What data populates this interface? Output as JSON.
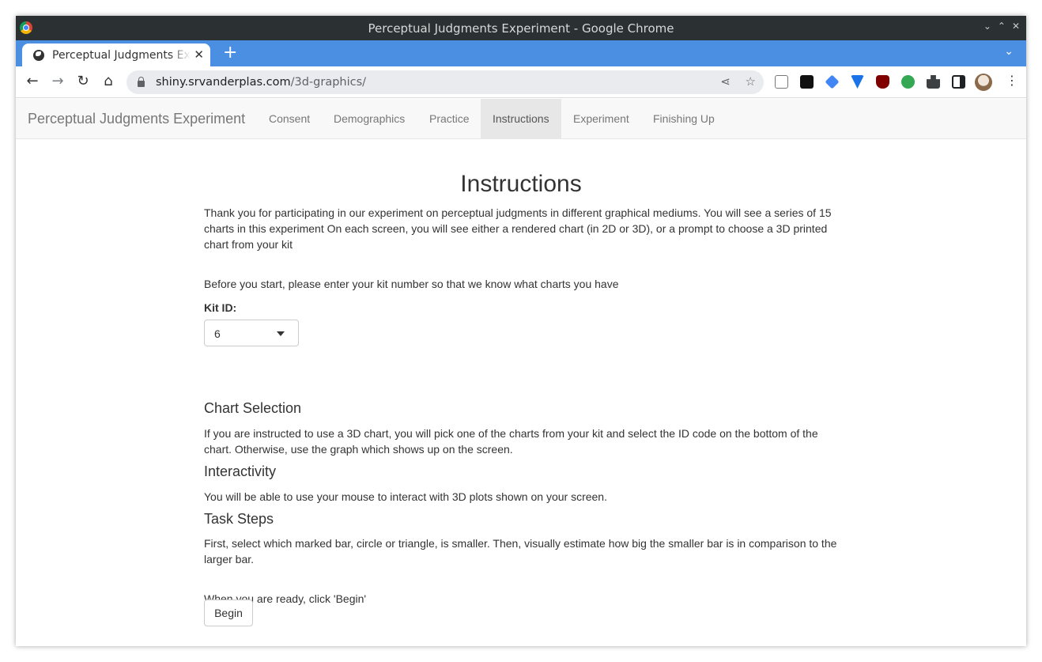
{
  "window": {
    "title": "Perceptual Judgments Experiment - Google Chrome",
    "controls": [
      "⌄",
      "⌃",
      "✕"
    ]
  },
  "browser": {
    "tab_title": "Perceptual Judgments Experiment",
    "tab_close": "✕",
    "new_tab": "+",
    "tab_menu": "⌄",
    "url_host": "shiny.srvanderplas.com",
    "url_path": "/3d-graphics/",
    "nav": {
      "back": "←",
      "forward": "→",
      "reload": "↻",
      "home": "⌂"
    },
    "share": "⋖",
    "star": "☆",
    "menu": "⋮",
    "extensions": [
      {
        "name": "reader-mode-icon",
        "color": "#5f6368"
      },
      {
        "name": "notion-icon",
        "color": "#111111"
      },
      {
        "name": "graduation-cap-icon",
        "color": "#4285f4"
      },
      {
        "name": "v-extension-icon",
        "color": "#1a73e8"
      },
      {
        "name": "ublock-origin-icon",
        "color": "#800000"
      },
      {
        "name": "green-extension-icon",
        "color": "#34a853"
      },
      {
        "name": "puzzle-piece-icon",
        "color": "#3c4043"
      },
      {
        "name": "side-panel-icon",
        "color": "#202124"
      }
    ]
  },
  "app": {
    "brand": "Perceptual Judgments Experiment",
    "nav": [
      {
        "label": "Consent",
        "active": false
      },
      {
        "label": "Demographics",
        "active": false
      },
      {
        "label": "Practice",
        "active": false
      },
      {
        "label": "Instructions",
        "active": true
      },
      {
        "label": "Experiment",
        "active": false
      },
      {
        "label": "Finishing Up",
        "active": false
      }
    ]
  },
  "page": {
    "heading": "Instructions",
    "intro": "Thank you for participating in our experiment on perceptual judgments in different graphical mediums. You will see a series of 15 charts in this experiment On each screen, you will see either a rendered chart (in 2D or 3D), or a prompt to choose a 3D printed chart from your kit",
    "kit_prompt": "Before you start, please enter your kit number so that we know what charts you have",
    "kit_label": "Kit ID:",
    "kit_value": "6",
    "chart_selection_heading": "Chart Selection",
    "chart_selection_text": "If you are instructed to use a 3D chart, you will pick one of the charts from your kit and select the ID code on the bottom of the chart. Otherwise, use the graph which shows up on the screen.",
    "interactivity_heading": "Interactivity",
    "interactivity_text": "You will be able to use your mouse to interact with 3D plots shown on your screen.",
    "task_steps_heading": "Task Steps",
    "task_steps_text": "First, select which marked bar, circle or triangle, is smaller. Then, visually estimate how big the smaller bar is in comparison to the larger bar.",
    "ready_text": "When you are ready, click 'Begin'",
    "begin_label": "Begin"
  }
}
